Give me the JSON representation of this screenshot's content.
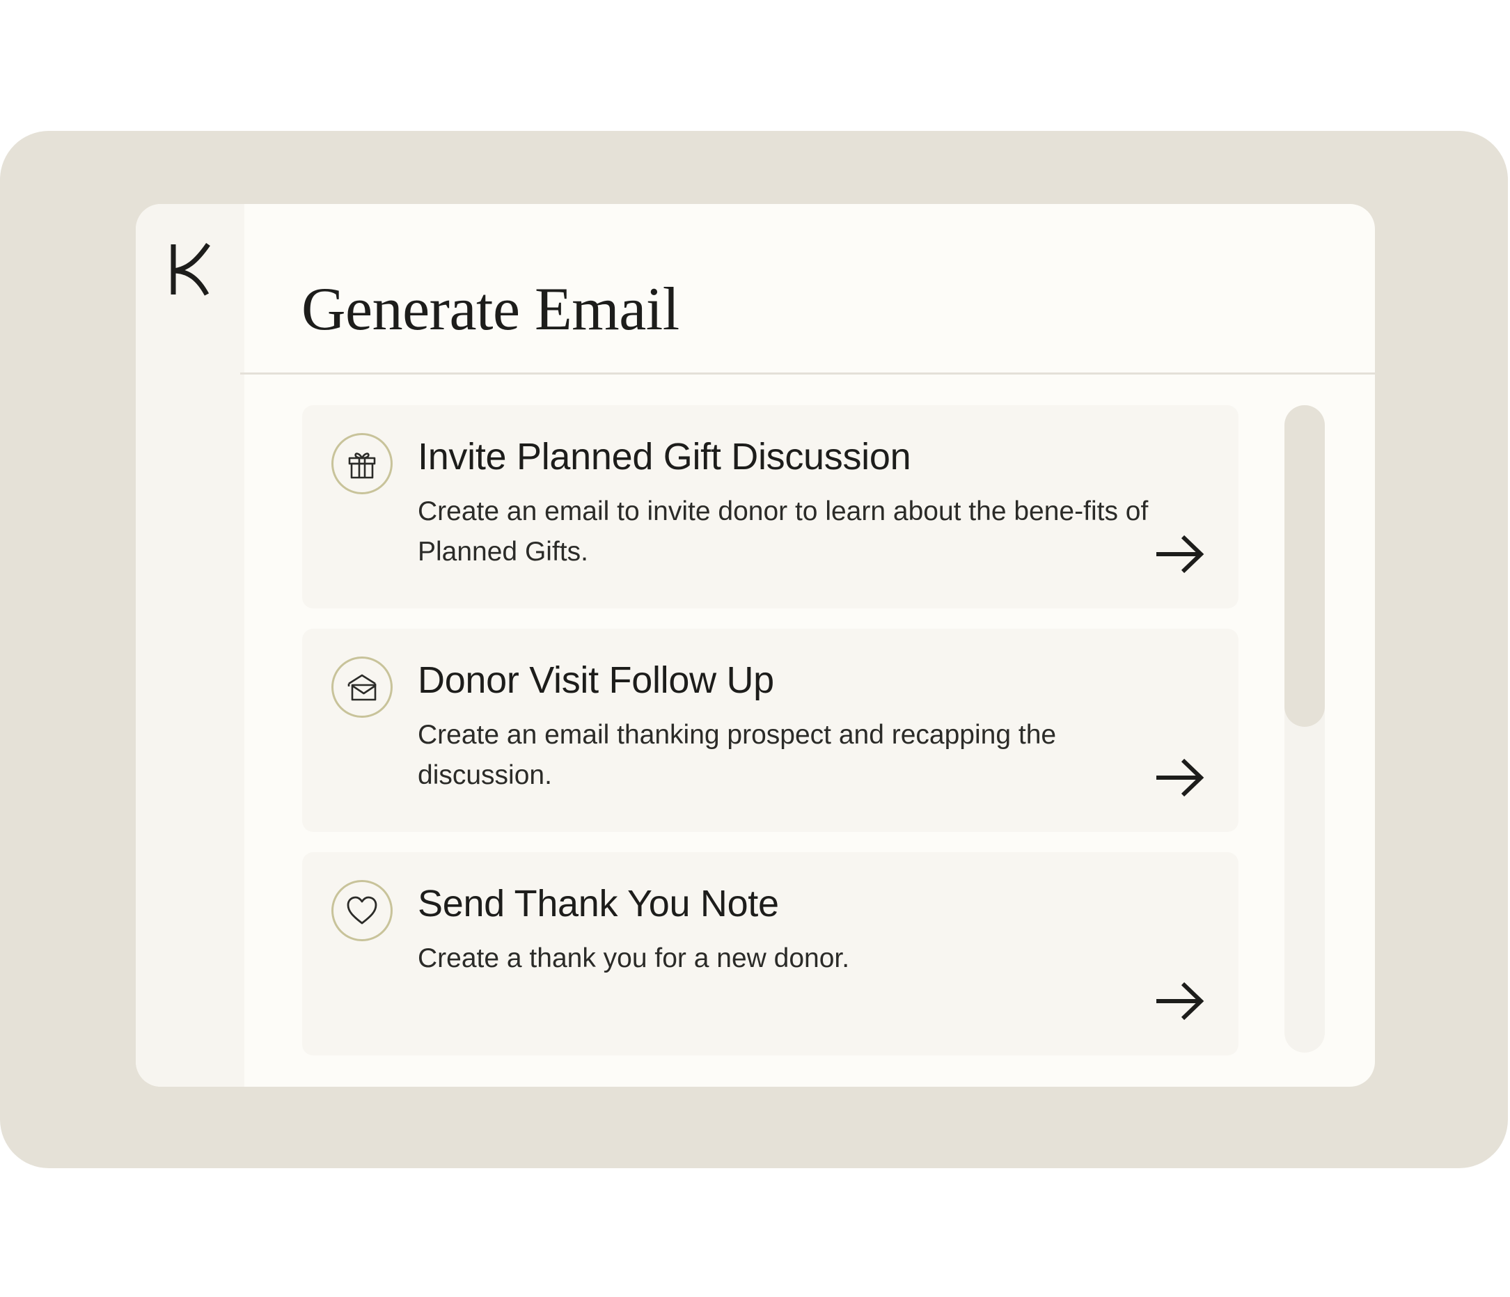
{
  "app": {
    "logo": "K"
  },
  "header": {
    "title": "Generate Email"
  },
  "cards": [
    {
      "icon": "gift-icon",
      "title": "Invite Planned Gift Discussion",
      "description": "Create an email to invite donor to learn about the bene-fits of Planned Gifts.",
      "arrow_icon": "arrow-right-icon"
    },
    {
      "icon": "open-envelope-icon",
      "title": "Donor Visit Follow Up",
      "description": "Create an email thanking prospect and recapping the discussion.",
      "arrow_icon": "arrow-right-icon"
    },
    {
      "icon": "heart-icon",
      "title": "Send Thank You Note",
      "description": "Create a thank you for a new donor.",
      "arrow_icon": "arrow-right-icon"
    }
  ],
  "colors": {
    "stage_background": "#e5e1d7",
    "window_background": "#fdfcf8",
    "card_background": "#f8f6f1",
    "icon_ring": "#c8c39a",
    "text": "#1d1d1b"
  }
}
